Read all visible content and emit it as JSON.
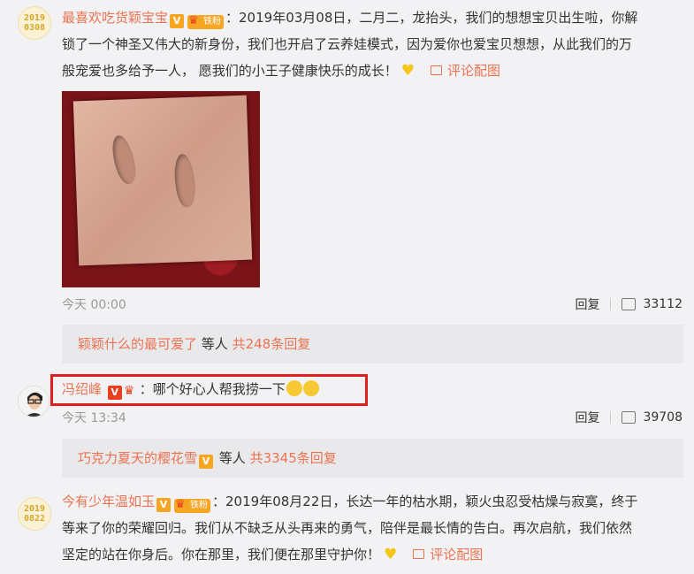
{
  "comments": [
    {
      "avatar_text": [
        "2019",
        "0308"
      ],
      "username": "最喜欢吃货颖宝宝",
      "fan_badge": "铁粉",
      "text_line1": "：2019年03月08日，二月二，龙抬头，我们的想想宝贝出生啦，你解",
      "text_line2": "锁了一个神圣又伟大的新身份，我们也开启了云养娃模式，因为爱你也爱宝贝想想，从此我们的万",
      "text_line3": "般宠爱也多给予一人， 愿我们的小王子健康快乐的成长！",
      "pic_link": "评论配图",
      "time": "今天 00:00",
      "reply_label": "回复",
      "likes": "33112",
      "sub_user": "颖颖什么的最可爱了",
      "sub_mid": " 等人 ",
      "sub_count": "共248条回复"
    },
    {
      "username": "冯绍峰",
      "text": "：哪个好心人帮我捞一下",
      "time": "今天 13:34",
      "reply_label": "回复",
      "likes": "39708",
      "sub_user": "巧克力夏天的樱花雪",
      "sub_mid": " 等人 ",
      "sub_count": "共3345条回复"
    },
    {
      "avatar_text": [
        "2019",
        "0822"
      ],
      "username": "今有少年温如玉",
      "fan_badge": "铁粉",
      "text_line1": "：2019年08月22日，长达一年的枯水期，颖火虫忍受枯燥与寂寞，终于",
      "text_line2": "等来了你的荣耀回归。我们从不缺乏从头再来的勇气，陪伴是最长情的告白。再次启航，我们依然",
      "text_line3": "坚定的站在你身后。你在那里，我们便在那里守护你！",
      "pic_link": "评论配图"
    }
  ],
  "colors": {
    "accent": "#eb7350",
    "highlight": "#e0201e",
    "badge": "#f6a623"
  }
}
